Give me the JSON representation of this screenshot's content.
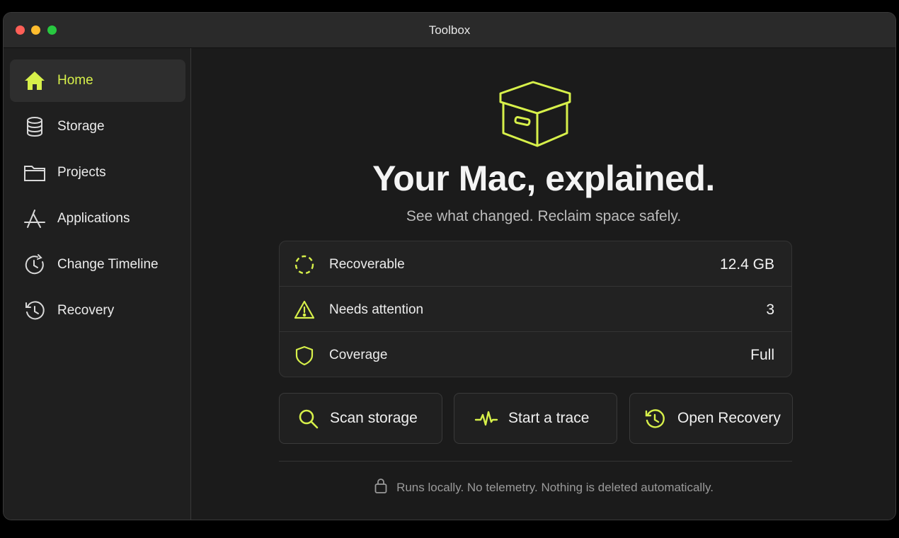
{
  "window": {
    "title": "Toolbox"
  },
  "sidebar": {
    "items": [
      {
        "label": "Home",
        "icon": "home-icon",
        "active": true
      },
      {
        "label": "Storage",
        "icon": "database-icon"
      },
      {
        "label": "Projects",
        "icon": "folder-icon"
      },
      {
        "label": "Applications",
        "icon": "app-store-icon"
      },
      {
        "label": "Change Timeline",
        "icon": "clock-history-icon"
      },
      {
        "label": "Recovery",
        "icon": "restore-icon"
      }
    ]
  },
  "main": {
    "hero_icon": "archive-box-icon",
    "headline": "Your Mac, explained.",
    "subheadline": "See what changed. Reclaim space safely.",
    "stats": [
      {
        "label": "Recoverable",
        "value": "12.4 GB",
        "icon": "dashed-circle-icon"
      },
      {
        "label": "Needs attention",
        "value": "3",
        "icon": "warning-icon"
      },
      {
        "label": "Coverage",
        "value": "Full",
        "icon": "shield-icon"
      }
    ],
    "actions": [
      {
        "label": "Scan storage",
        "icon": "search-icon"
      },
      {
        "label": "Start a trace",
        "icon": "pulse-icon"
      },
      {
        "label": "Open Recovery",
        "icon": "restore-icon"
      }
    ],
    "footer": {
      "text": "Runs locally. No telemetry. Nothing is deleted automatically.",
      "icon": "lock-icon"
    }
  },
  "colors": {
    "accent": "#d7f04a",
    "background": "#1b1b1b",
    "sidebar": "#1f1f1f"
  }
}
